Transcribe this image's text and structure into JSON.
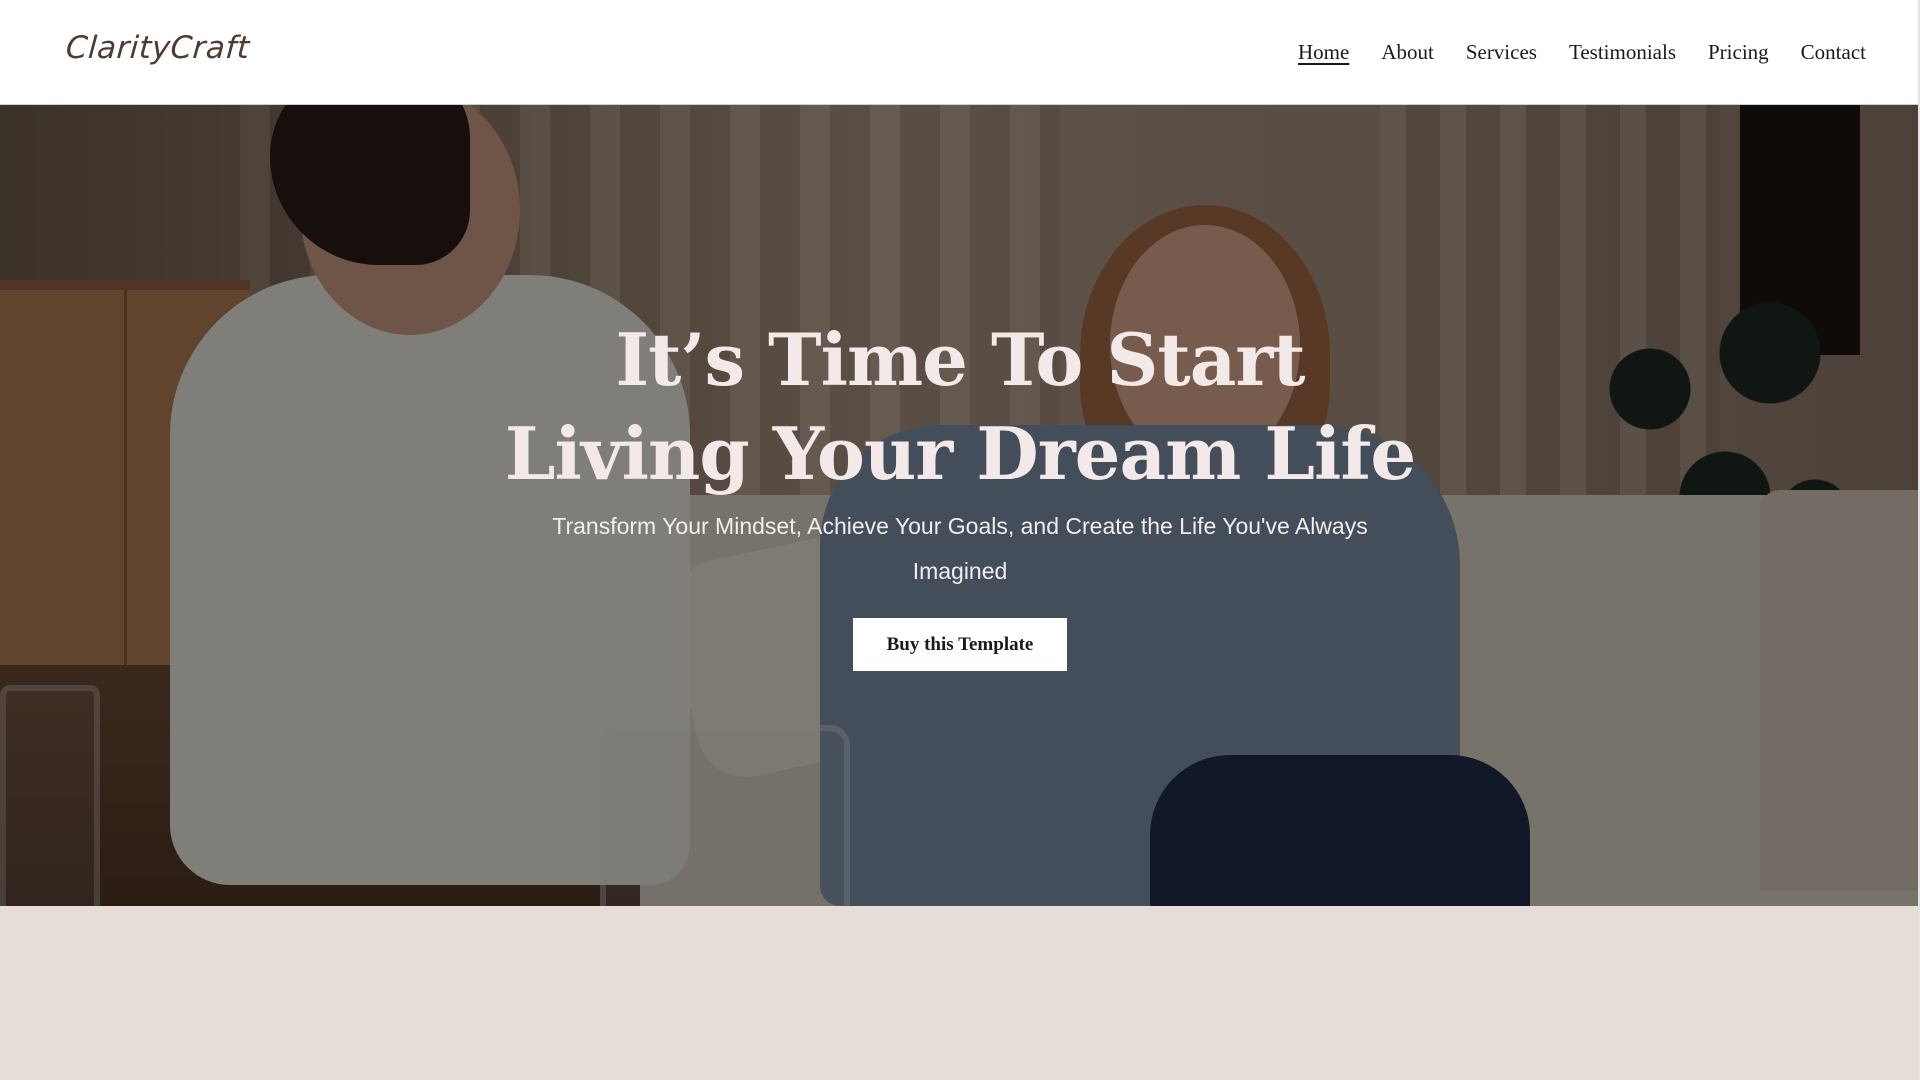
{
  "header": {
    "logo": "ClarityCraft",
    "nav": [
      {
        "label": "Home",
        "active": true
      },
      {
        "label": "About",
        "active": false
      },
      {
        "label": "Services",
        "active": false
      },
      {
        "label": "Testimonials",
        "active": false
      },
      {
        "label": "Pricing",
        "active": false
      },
      {
        "label": "Contact",
        "active": false
      }
    ]
  },
  "hero": {
    "title_line1": "It’s Time To Start",
    "title_line2": "Living Your Dream Life",
    "subtitle_line1": "Transform Your Mindset, Achieve Your Goals, and Create the Life You've Always",
    "subtitle_line2": "Imagined",
    "cta_label": "Buy this Template",
    "background_image": "two-women-coaching-session-on-sofa"
  },
  "colors": {
    "header_bg": "#ffffff",
    "logo": "#4e3b31",
    "hero_text": "#f3e9e9",
    "section_bg": "#e6ddd8",
    "button_bg": "#ffffff",
    "button_text": "#1a1a1a"
  }
}
